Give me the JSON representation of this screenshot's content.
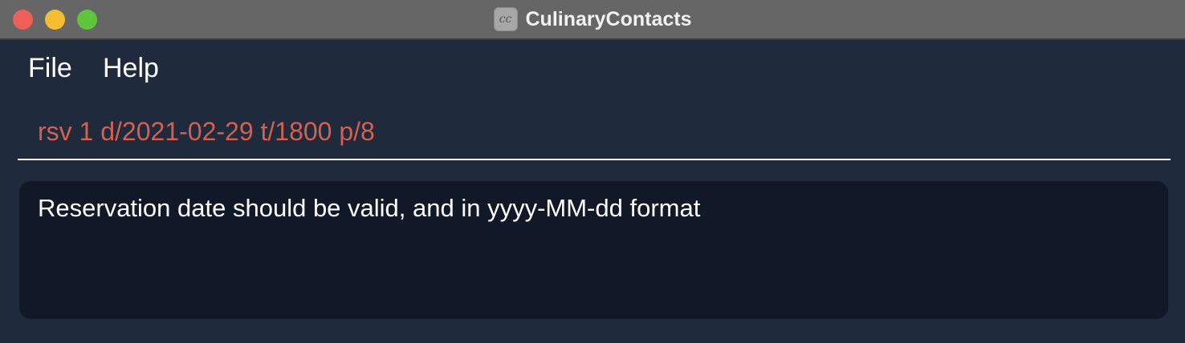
{
  "window": {
    "title": "CulinaryContacts",
    "app_icon_text": "cc"
  },
  "menu": {
    "items": [
      "File",
      "Help"
    ]
  },
  "command": {
    "value": "rsv 1 d/2021-02-29 t/1800 p/8"
  },
  "result": {
    "message": "Reservation date should be valid, and in yyyy-MM-dd format"
  },
  "colors": {
    "background": "#202a3d",
    "titlebar": "#666666",
    "command_text": "#d4604f",
    "result_background": "#111828"
  }
}
